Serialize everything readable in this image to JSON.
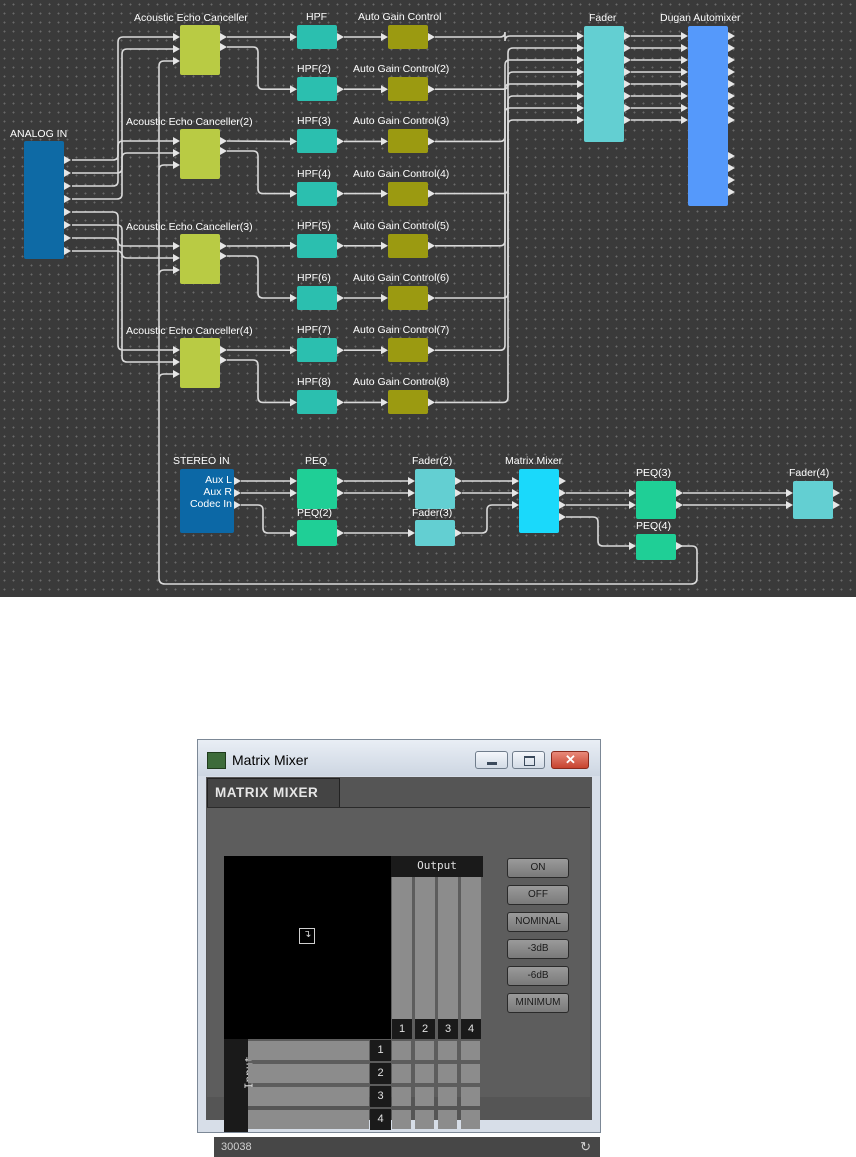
{
  "colors": {
    "canvas": "#3a3a3a",
    "analog_in": "#0e6aa5",
    "aec": "#b9cb44",
    "hpf": "#2bbfaf",
    "agc": "#9b9a11",
    "fader": "#63cfd2",
    "automixer": "#5599fb",
    "stereo_in": "#0c68a6",
    "peq": "#1fcf96",
    "matrix_mixer": "#1ad9fb"
  },
  "diagram": {
    "analog_in": "ANALOG IN",
    "aec": [
      "Acoustic Echo Canceller",
      "Acoustic Echo Canceller(2)",
      "Acoustic Echo Canceller(3)",
      "Acoustic Echo Canceller(4)"
    ],
    "hpf": [
      "HPF",
      "HPF(2)",
      "HPF(3)",
      "HPF(4)",
      "HPF(5)",
      "HPF(6)",
      "HPF(7)",
      "HPF(8)"
    ],
    "agc": [
      "Auto Gain Control",
      "Auto Gain Control(2)",
      "Auto Gain Control(3)",
      "Auto Gain Control(4)",
      "Auto Gain Control(5)",
      "Auto Gain Control(6)",
      "Auto Gain Control(7)",
      "Auto Gain Control(8)"
    ],
    "fader": "Fader",
    "automixer": "Dugan Automixer",
    "stereo_in": "STEREO IN",
    "stereo_in_ports": [
      "Aux L",
      "Aux R",
      "Codec In"
    ],
    "peq": "PEQ",
    "peq2": "PEQ(2)",
    "fader2": "Fader(2)",
    "fader3": "Fader(3)",
    "matrix_mixer": "Matrix Mixer",
    "peq3": "PEQ(3)",
    "peq4": "PEQ(4)",
    "fader4": "Fader(4)"
  },
  "dialog": {
    "title": "Matrix Mixer",
    "tab": "MATRIX MIXER",
    "output_label": "Output",
    "input_label": "Input",
    "outputs": [
      "1",
      "2",
      "3",
      "4"
    ],
    "inputs": [
      "1",
      "2",
      "3",
      "4"
    ],
    "buttons": [
      "ON",
      "OFF",
      "NOMINAL",
      "-3dB",
      "-6dB",
      "MINIMUM"
    ],
    "status": "30038"
  }
}
